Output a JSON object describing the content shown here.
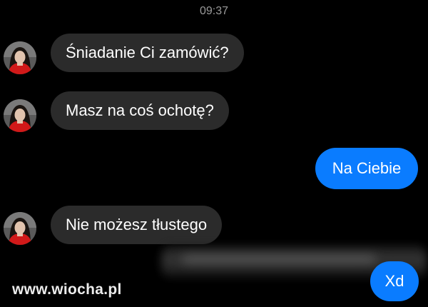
{
  "chat": {
    "timestamp": "09:37",
    "messages": [
      {
        "direction": "incoming",
        "text": "Śniadanie Ci zamówić?"
      },
      {
        "direction": "incoming",
        "text": "Masz na coś ochotę?"
      },
      {
        "direction": "outgoing",
        "text": "Na Ciebie"
      },
      {
        "direction": "incoming",
        "text": "Nie możesz tłustego"
      },
      {
        "direction": "outgoing",
        "text": "Xd"
      }
    ]
  },
  "watermark": "www.wiocha.pl",
  "colors": {
    "background": "#000000",
    "incoming_bubble": "#2b2b2b",
    "outgoing_bubble": "#0a7cff",
    "timestamp_text": "#9a9a9a"
  }
}
